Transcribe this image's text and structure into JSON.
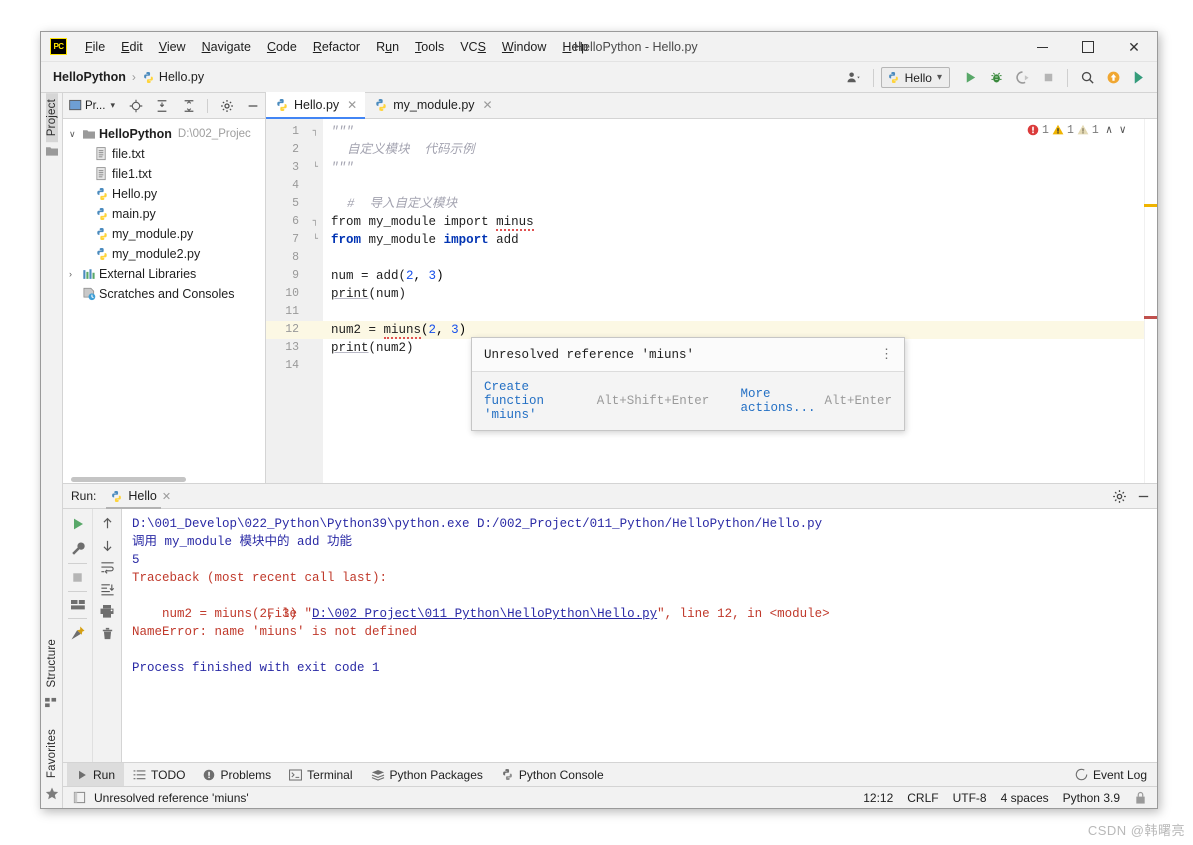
{
  "window": {
    "title": "HelloPython - Hello.py",
    "logo_text": "PC",
    "minimize": "─",
    "maximize": "□",
    "close": "✕"
  },
  "menu": {
    "items": [
      "File",
      "Edit",
      "View",
      "Navigate",
      "Code",
      "Refactor",
      "Run",
      "Tools",
      "VCS",
      "Window",
      "Help"
    ]
  },
  "breadcrumb": {
    "project": "HelloPython",
    "separator": "›",
    "file": "Hello.py"
  },
  "toolbar": {
    "run_config": "Hello",
    "chevron": "⌄",
    "icons": [
      "user-icon",
      "run-icon",
      "debug-icon",
      "run-coverage-icon",
      "stop-icon",
      "search-icon",
      "update-icon",
      "ide-assistant-icon"
    ]
  },
  "left_strip": {
    "project_tab": "Project",
    "structure_tab": "Structure",
    "favorites_tab": "Favorites"
  },
  "project_panel": {
    "title": "Pr...",
    "title_chevron": "▾",
    "tree": [
      {
        "label": "HelloPython",
        "path": "D:\\002_Projec",
        "icon": "folder-icon",
        "twist": "∨",
        "indent": 0,
        "bold": true
      },
      {
        "label": "file.txt",
        "path": "",
        "icon": "text-file-icon",
        "twist": "",
        "indent": 1,
        "bold": false
      },
      {
        "label": "file1.txt",
        "path": "",
        "icon": "text-file-icon",
        "twist": "",
        "indent": 1,
        "bold": false
      },
      {
        "label": "Hello.py",
        "path": "",
        "icon": "python-file-icon",
        "twist": "",
        "indent": 1,
        "bold": false
      },
      {
        "label": "main.py",
        "path": "",
        "icon": "python-file-icon",
        "twist": "",
        "indent": 1,
        "bold": false
      },
      {
        "label": "my_module.py",
        "path": "",
        "icon": "python-file-icon",
        "twist": "",
        "indent": 1,
        "bold": false
      },
      {
        "label": "my_module2.py",
        "path": "",
        "icon": "python-file-icon",
        "twist": "",
        "indent": 1,
        "bold": false
      },
      {
        "label": "External Libraries",
        "path": "",
        "icon": "libraries-icon",
        "twist": "›",
        "indent": 0,
        "bold": false
      },
      {
        "label": "Scratches and Consoles",
        "path": "",
        "icon": "scratches-icon",
        "twist": "",
        "indent": 0,
        "bold": false
      }
    ]
  },
  "editor": {
    "tabs": [
      {
        "label": "Hello.py",
        "active": true,
        "close": "✕"
      },
      {
        "label": "my_module.py",
        "active": false,
        "close": "✕"
      }
    ],
    "inspection_counts": {
      "errors": "1",
      "warnings": "1",
      "weak_warnings": "1",
      "up": "∧",
      "down": "∨"
    },
    "lines": [
      {
        "n": "1",
        "fold": "┐"
      },
      {
        "n": "2",
        "fold": ""
      },
      {
        "n": "3",
        "fold": "└"
      },
      {
        "n": "4",
        "fold": ""
      },
      {
        "n": "5",
        "fold": ""
      },
      {
        "n": "6",
        "fold": "┐"
      },
      {
        "n": "7",
        "fold": "└"
      },
      {
        "n": "8",
        "fold": ""
      },
      {
        "n": "9",
        "fold": ""
      },
      {
        "n": "10",
        "fold": ""
      },
      {
        "n": "11",
        "fold": ""
      },
      {
        "n": "12",
        "fold": ""
      },
      {
        "n": "13",
        "fold": ""
      },
      {
        "n": "14",
        "fold": ""
      }
    ],
    "code": {
      "l1": "\"\"\"",
      "l2": "自定义模块  代码示例",
      "l3": "\"\"\"",
      "l5": "#  导入自定义模块",
      "l6_from": "from",
      "l6_module": "my_module",
      "l6_import": "import",
      "l6_name": "minus",
      "l7_from": "from",
      "l7_module": "my_module",
      "l7_import": "import",
      "l7_name": "add",
      "l9": "num = add(",
      "l9_a": "2",
      "l9_mid": ", ",
      "l9_b": "3",
      "l9_end": ")",
      "l10_print": "print",
      "l10_arg": "(num)",
      "l12_pre": "num2 = ",
      "l12_call": "miuns",
      "l12_open": "(",
      "l12_a": "2",
      "l12_mid": ", ",
      "l12_b": "3",
      "l12_close": ")",
      "l13_print": "print",
      "l13_arg": "(num2)"
    }
  },
  "popup": {
    "message": "Unresolved reference 'miuns'",
    "kebab": "⋮",
    "action_create": "Create function 'miuns'",
    "shortcut_create": "Alt+Shift+Enter",
    "action_more": "More actions...",
    "shortcut_more": "Alt+Enter"
  },
  "run_window": {
    "label": "Run:",
    "tab_name": "Hello",
    "tab_close": "✕",
    "settings_icon": "gear-icon",
    "minimize_icon": "minimize-icon",
    "console_lines": [
      {
        "text": "D:\\001_Develop\\022_Python\\Python39\\python.exe D:/002_Project/011_Python/HelloPython/Hello.py",
        "style": "blue"
      },
      {
        "text": "调用 my_module 模块中的 add 功能",
        "style": "blue"
      },
      {
        "text": "5",
        "style": "blue"
      },
      {
        "text": "Traceback (most recent call last):",
        "style": "red"
      },
      {
        "text": "  File \"D:\\002 Project\\011 Python\\HelloPython\\Hello.py\", line 12, in <module>",
        "style": "red-link"
      },
      {
        "text": "    num2 = miuns(2, 3)",
        "style": "red"
      },
      {
        "text": "NameError: name 'miuns' is not defined",
        "style": "red"
      },
      {
        "text": "",
        "style": "blue"
      },
      {
        "text": "Process finished with exit code 1",
        "style": "blue"
      }
    ]
  },
  "bottom_tabs": [
    {
      "label": "Run",
      "icon": "run-icon",
      "selected": true
    },
    {
      "label": "TODO",
      "icon": "todo-icon",
      "selected": false
    },
    {
      "label": "Problems",
      "icon": "problems-icon",
      "selected": false
    },
    {
      "label": "Terminal",
      "icon": "terminal-icon",
      "selected": false
    },
    {
      "label": "Python Packages",
      "icon": "packages-icon",
      "selected": false
    },
    {
      "label": "Python Console",
      "icon": "python-console-icon",
      "selected": false
    }
  ],
  "event_log": {
    "label": "Event Log",
    "icon": "event-log-icon"
  },
  "status_bar": {
    "message": "Unresolved reference 'miuns'",
    "caret": "12:12",
    "line_sep": "CRLF",
    "encoding": "UTF-8",
    "indent": "4 spaces",
    "interpreter": "Python 3.9",
    "lock_icon": "lock-icon"
  },
  "watermark": "CSDN @韩曙亮",
  "colors": {
    "accent": "#4285f4",
    "error": "#c0392b",
    "keyword": "#0033b3",
    "number": "#1750eb",
    "comment": "#a3a3b0",
    "highlight": "#fcf8e4"
  }
}
